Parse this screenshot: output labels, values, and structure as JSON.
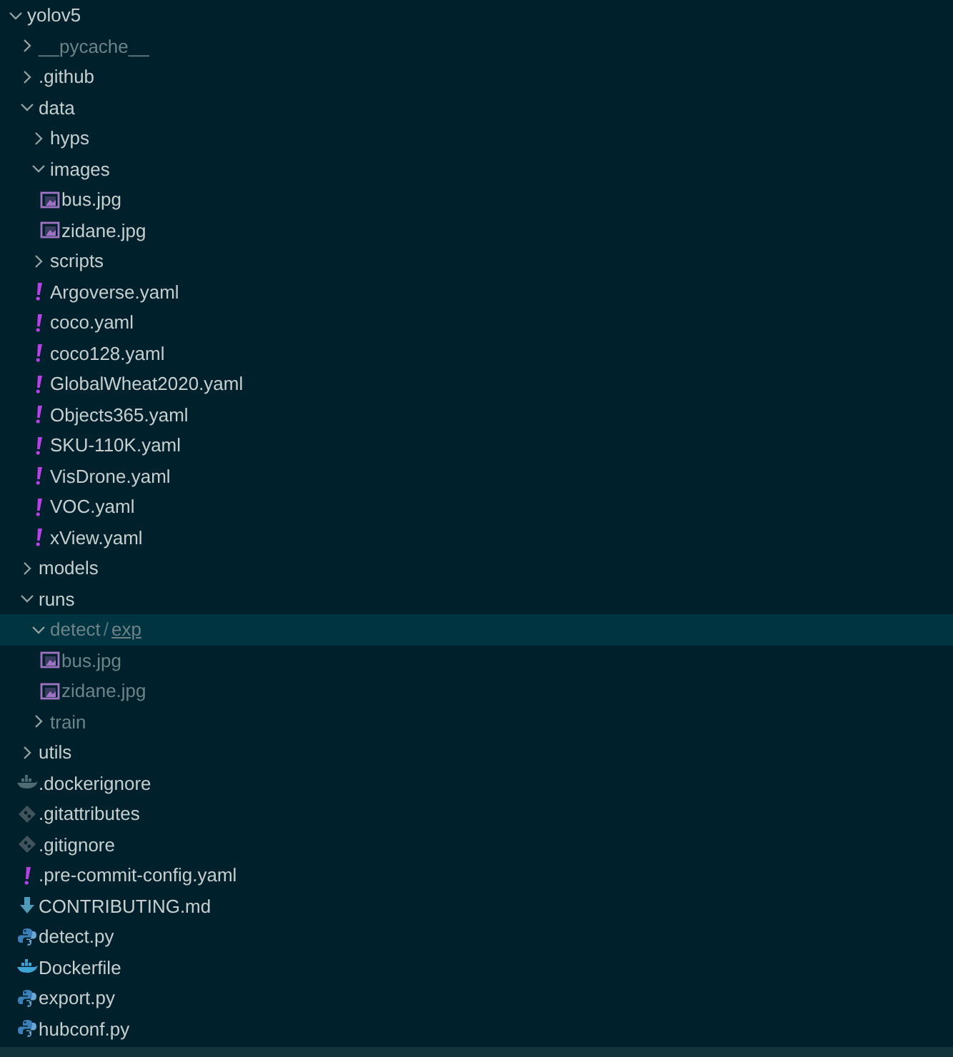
{
  "explorer": {
    "items": [
      {
        "name": "yolov5",
        "kind": "folder",
        "expanded": true,
        "selected": false,
        "ignored": false,
        "children": [
          {
            "name": "__pycache__",
            "kind": "folder",
            "expanded": false,
            "selected": false,
            "ignored": true
          },
          {
            "name": ".github",
            "kind": "folder",
            "expanded": false,
            "selected": false,
            "ignored": false
          },
          {
            "name": "data",
            "kind": "folder",
            "expanded": true,
            "selected": false,
            "ignored": false,
            "children": [
              {
                "name": "hyps",
                "kind": "folder",
                "expanded": false,
                "selected": false,
                "ignored": false
              },
              {
                "name": "images",
                "kind": "folder",
                "expanded": true,
                "selected": false,
                "ignored": false,
                "children": [
                  {
                    "name": "bus.jpg",
                    "kind": "image",
                    "selected": false,
                    "ignored": false
                  },
                  {
                    "name": "zidane.jpg",
                    "kind": "image",
                    "selected": false,
                    "ignored": false
                  }
                ]
              },
              {
                "name": "scripts",
                "kind": "folder",
                "expanded": false,
                "selected": false,
                "ignored": false
              },
              {
                "name": "Argoverse.yaml",
                "kind": "yaml",
                "selected": false,
                "ignored": false
              },
              {
                "name": "coco.yaml",
                "kind": "yaml",
                "selected": false,
                "ignored": false
              },
              {
                "name": "coco128.yaml",
                "kind": "yaml",
                "selected": false,
                "ignored": false
              },
              {
                "name": "GlobalWheat2020.yaml",
                "kind": "yaml",
                "selected": false,
                "ignored": false
              },
              {
                "name": "Objects365.yaml",
                "kind": "yaml",
                "selected": false,
                "ignored": false
              },
              {
                "name": "SKU-110K.yaml",
                "kind": "yaml",
                "selected": false,
                "ignored": false
              },
              {
                "name": "VisDrone.yaml",
                "kind": "yaml",
                "selected": false,
                "ignored": false
              },
              {
                "name": "VOC.yaml",
                "kind": "yaml",
                "selected": false,
                "ignored": false
              },
              {
                "name": "xView.yaml",
                "kind": "yaml",
                "selected": false,
                "ignored": false
              }
            ]
          },
          {
            "name": "models",
            "kind": "folder",
            "expanded": false,
            "selected": false,
            "ignored": false
          },
          {
            "name": "runs",
            "kind": "folder",
            "expanded": true,
            "selected": false,
            "ignored": false,
            "children": [
              {
                "name": "detect",
                "separator": "/",
                "compact_child": "exp",
                "kind": "folder",
                "expanded": true,
                "selected": true,
                "ignored": true,
                "children": [
                  {
                    "name": "bus.jpg",
                    "kind": "image",
                    "selected": false,
                    "ignored": true
                  },
                  {
                    "name": "zidane.jpg",
                    "kind": "image",
                    "selected": false,
                    "ignored": true
                  }
                ]
              },
              {
                "name": "train",
                "kind": "folder",
                "expanded": false,
                "selected": false,
                "ignored": true
              }
            ]
          },
          {
            "name": "utils",
            "kind": "folder",
            "expanded": false,
            "selected": false,
            "ignored": false
          },
          {
            "name": ".dockerignore",
            "kind": "dockerignore",
            "selected": false,
            "ignored": false
          },
          {
            "name": ".gitattributes",
            "kind": "git",
            "selected": false,
            "ignored": false
          },
          {
            "name": ".gitignore",
            "kind": "git",
            "selected": false,
            "ignored": false
          },
          {
            "name": ".pre-commit-config.yaml",
            "kind": "yaml",
            "selected": false,
            "ignored": false
          },
          {
            "name": "CONTRIBUTING.md",
            "kind": "markdown",
            "selected": false,
            "ignored": false
          },
          {
            "name": "detect.py",
            "kind": "python",
            "selected": false,
            "ignored": false
          },
          {
            "name": "Dockerfile",
            "kind": "docker",
            "selected": false,
            "ignored": false
          },
          {
            "name": "export.py",
            "kind": "python",
            "selected": false,
            "ignored": false
          },
          {
            "name": "hubconf.py",
            "kind": "python",
            "selected": false,
            "ignored": false
          }
        ]
      }
    ]
  }
}
